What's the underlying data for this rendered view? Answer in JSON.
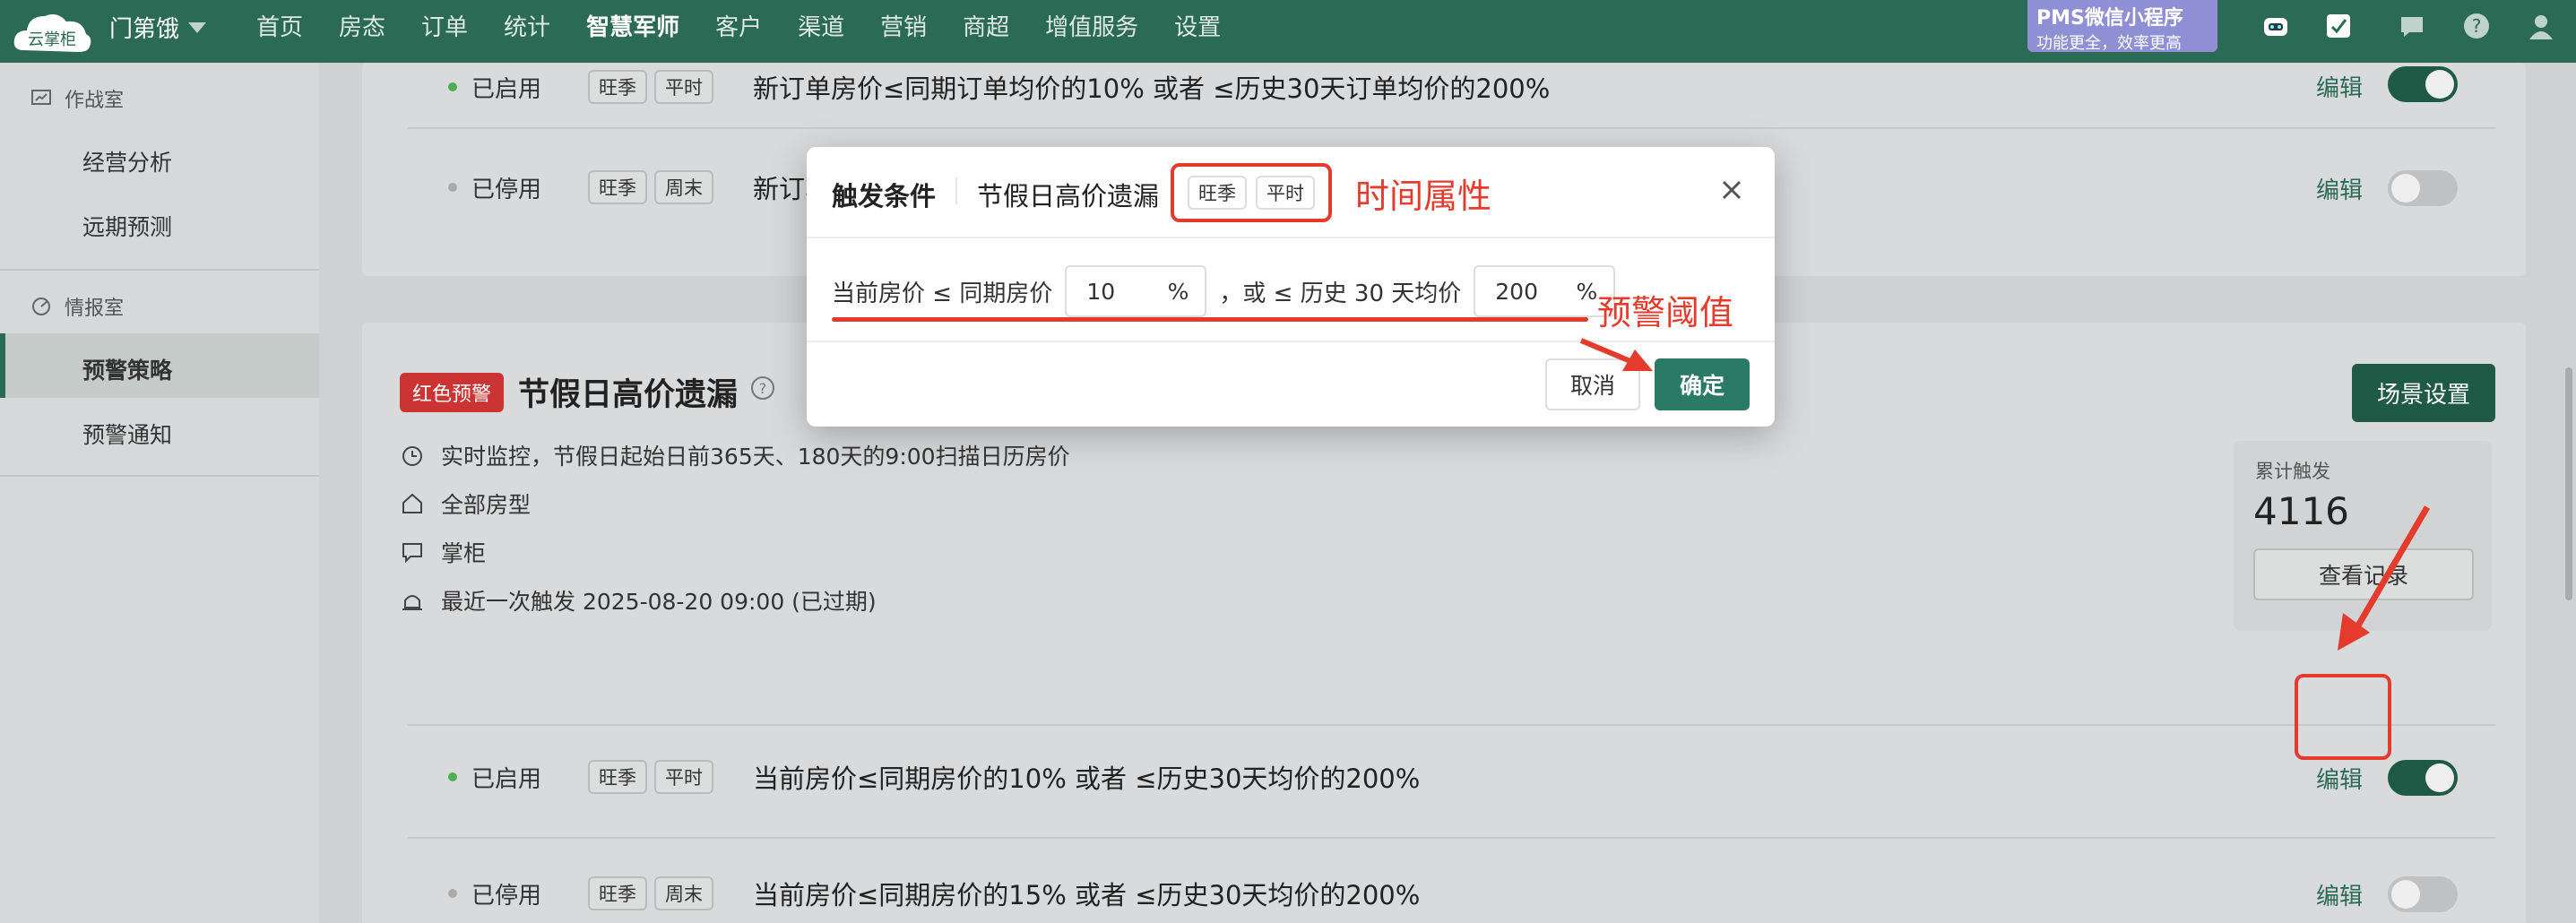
{
  "topbar": {
    "logo_text": "云掌柜",
    "store_name": "门第饿",
    "nav": [
      "首页",
      "房态",
      "订单",
      "统计",
      "智慧军师",
      "客户",
      "渠道",
      "营销",
      "商超",
      "增值服务",
      "设置"
    ],
    "active_nav": "智慧军师",
    "pms_line1": "PMS微信小程序",
    "pms_line2": "功能更全，效率更高",
    "icons": [
      "robot-icon",
      "edit-badge-icon",
      "chat-icon",
      "help-icon",
      "user-icon"
    ]
  },
  "sidebar": {
    "group1": "作战室",
    "group1_items": [
      "经营分析",
      "远期预测"
    ],
    "group2": "情报室",
    "group2_items": [
      "预警策略",
      "预警通知"
    ],
    "active_item": "预警策略"
  },
  "upper_rules": [
    {
      "status": "已启用",
      "tags": [
        "旺季",
        "平时"
      ],
      "text": "新订单房价≤同期订单均价的10% 或者 ≤历史30天订单均价的200%",
      "edit": "编辑",
      "enabled": true
    },
    {
      "status": "已停用",
      "tags": [
        "旺季",
        "周末"
      ],
      "text": "新订单",
      "edit": "编辑",
      "enabled": false
    }
  ],
  "section": {
    "badge": "红色预警",
    "title": "节假日高价遗漏",
    "scene_button": "场景设置",
    "info": [
      {
        "icon": "alarm-clock-icon",
        "text": "实时监控，节假日起始日前365天、180天的9:00扫描日历房价"
      },
      {
        "icon": "home-icon",
        "text": "全部房型"
      },
      {
        "icon": "chat-bubble-icon",
        "text": "掌柜"
      },
      {
        "icon": "siren-icon",
        "text": "最近一次触发 2025-08-20 09:00 (已过期)"
      }
    ],
    "stat_label": "累计触发",
    "stat_value": "4116",
    "view_records": "查看记录",
    "rules": [
      {
        "status": "已启用",
        "tags": [
          "旺季",
          "平时"
        ],
        "text": "当前房价≤同期房价的10% 或者 ≤历史30天均价的200%",
        "edit": "编辑",
        "enabled": true
      },
      {
        "status": "已停用",
        "tags": [
          "旺季",
          "周末"
        ],
        "text": "当前房价≤同期房价的15% 或者 ≤历史30天均价的200%",
        "edit": "编辑",
        "enabled": false
      }
    ]
  },
  "modal": {
    "title": "触发条件",
    "subtitle": "节假日高价遗漏",
    "tags": [
      "旺季",
      "平时"
    ],
    "label1": "当前房价 ≤ 同期房价",
    "value1": "10",
    "unit1": "%",
    "label2": "，或 ≤ 历史 30 天均价",
    "value2": "200",
    "unit2": "%",
    "cancel": "取消",
    "confirm": "确定"
  },
  "annotations": {
    "time_attr": "时间属性",
    "threshold": "预警阈值"
  },
  "colors": {
    "brand": "#2b6a55",
    "accent_red": "#e53b2c",
    "confirm_button": "#2b7a66"
  }
}
